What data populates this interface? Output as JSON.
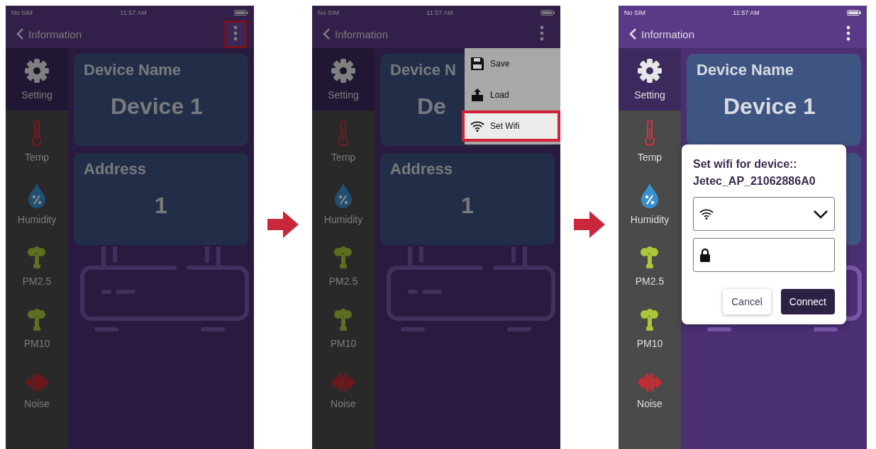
{
  "screens": [
    {
      "dimmed": true,
      "status_bar": {
        "carrier": "No SIM",
        "time": "11:57 AM"
      },
      "nav": {
        "back_label": "Information",
        "menu_highlighted": true
      },
      "sidebar": [
        {
          "kind": "gear",
          "label": "Setting",
          "selected": true
        },
        {
          "kind": "thermometer",
          "label": "Temp",
          "selected": false
        },
        {
          "kind": "drop",
          "label": "Humidity",
          "selected": false
        },
        {
          "kind": "plant",
          "label": "PM2.5",
          "selected": false
        },
        {
          "kind": "plant",
          "label": "PM10",
          "selected": false
        },
        {
          "kind": "wave",
          "label": "Noise",
          "selected": false
        }
      ],
      "cards": [
        {
          "kind": "name",
          "title": "Device Name",
          "value": "Device 1"
        },
        {
          "kind": "address",
          "title": "Address",
          "value": "1"
        }
      ]
    },
    {
      "dimmed": true,
      "status_bar": {
        "carrier": "No SIM",
        "time": "11:57 AM"
      },
      "nav": {
        "back_label": "Information",
        "menu_highlighted": false
      },
      "sidebar": [
        {
          "kind": "gear",
          "label": "Setting",
          "selected": true
        },
        {
          "kind": "thermometer",
          "label": "Temp",
          "selected": false
        },
        {
          "kind": "drop",
          "label": "Humidity",
          "selected": false
        },
        {
          "kind": "plant",
          "label": "PM2.5",
          "selected": false
        },
        {
          "kind": "plant",
          "label": "PM10",
          "selected": false
        },
        {
          "kind": "wave",
          "label": "Noise",
          "selected": false
        }
      ],
      "cards": [
        {
          "kind": "name",
          "title": "Device N",
          "value": "De"
        },
        {
          "kind": "address",
          "title": "Address",
          "value": "1"
        }
      ],
      "menu": [
        {
          "kind": "save",
          "label": "Save",
          "highlighted": false
        },
        {
          "kind": "load",
          "label": "Load",
          "highlighted": false
        },
        {
          "kind": "wifi",
          "label": "Set Wifi",
          "highlighted": true
        }
      ]
    },
    {
      "dimmed": false,
      "status_bar": {
        "carrier": "No SIM",
        "time": "11:57 AM"
      },
      "nav": {
        "back_label": "Information",
        "menu_highlighted": false
      },
      "sidebar": [
        {
          "kind": "gear",
          "label": "Setting",
          "selected": true
        },
        {
          "kind": "thermometer",
          "label": "Temp",
          "selected": false
        },
        {
          "kind": "drop",
          "label": "Humidity",
          "selected": false
        },
        {
          "kind": "plant",
          "label": "PM2.5",
          "selected": false
        },
        {
          "kind": "plant",
          "label": "PM10",
          "selected": false
        },
        {
          "kind": "wave",
          "label": "Noise",
          "selected": false
        }
      ],
      "cards": [
        {
          "kind": "name",
          "title": "Device Name",
          "value": "Device 1"
        },
        {
          "kind": "address"
        }
      ],
      "dialog": {
        "title": "Set wifi for device::",
        "device": "Jetec_AP_21062886A0",
        "buttons": [
          "Cancel",
          "Connect"
        ]
      }
    }
  ]
}
